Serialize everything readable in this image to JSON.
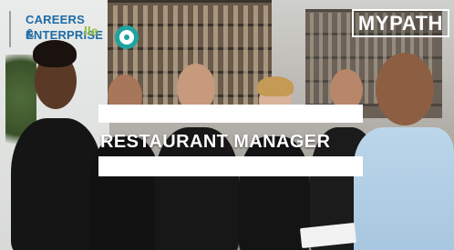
{
  "logos": {
    "careers_enterprise": {
      "line1": "CAREERS &",
      "line2": "ENTERPRISE",
      "prefix": "the"
    },
    "lep": {
      "text": "lle"
    },
    "circle": {
      "color": "#1fa3a0"
    }
  },
  "badge": {
    "text": "MYPATH"
  },
  "headline": {
    "text": "RESTAURANT MANAGER"
  },
  "colors": {
    "brand_blue": "#1f6aa6",
    "lep_green": "#8fbf3e",
    "teal": "#1fa3a0",
    "white": "#ffffff"
  }
}
